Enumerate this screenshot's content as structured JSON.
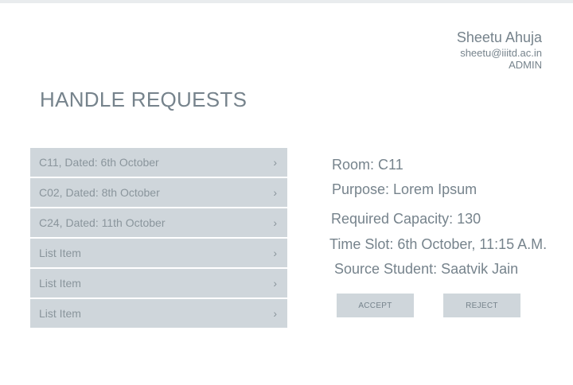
{
  "user": {
    "name": "Sheetu Ahuja",
    "email": "sheetu@iiitd.ac.in",
    "role": "ADMIN"
  },
  "page_title": "HANDLE REQUESTS",
  "requests": [
    {
      "label": "C11, Dated: 6th October",
      "chevron": "›"
    },
    {
      "label": "C02, Dated: 8th October",
      "chevron": "›"
    },
    {
      "label": "C24, Dated: 11th October",
      "chevron": "›"
    },
    {
      "label": "List Item",
      "chevron": "›"
    },
    {
      "label": "List Item",
      "chevron": "›"
    },
    {
      "label": "List Item",
      "chevron": "›"
    }
  ],
  "details": {
    "room": "Room: C11",
    "purpose": "Purpose: Lorem Ipsum",
    "capacity": "Required Capacity: 130",
    "time_slot": "Time Slot: 6th October, 11:15 A.M.",
    "source": "Source Student: Saatvik Jain"
  },
  "actions": {
    "accept": "ACCEPT",
    "reject": "REJECT"
  },
  "colors": {
    "panel": "#cfd6db",
    "text": "#76838c"
  }
}
